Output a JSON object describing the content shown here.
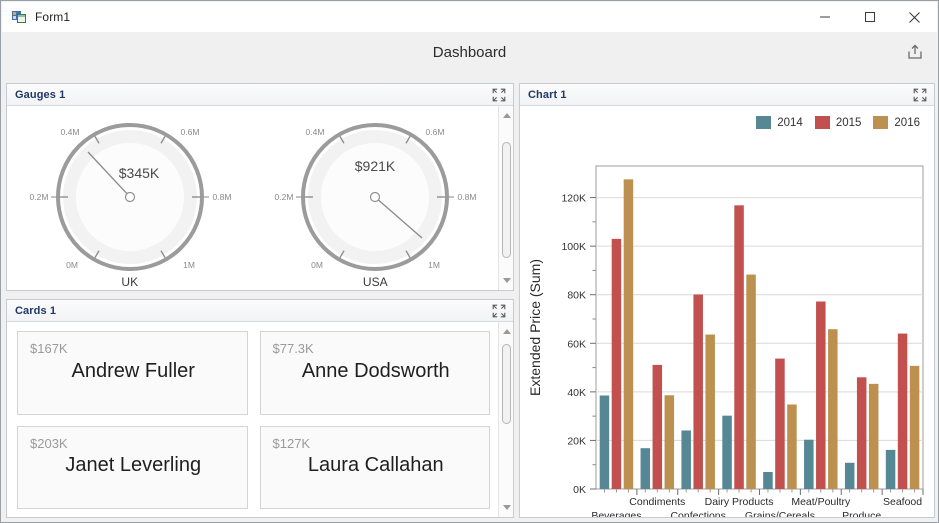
{
  "window": {
    "title": "Form1",
    "icon": "form-app-icon",
    "buttons": {
      "minimize": "minimize-icon",
      "maximize": "maximize-icon",
      "close": "close-icon"
    }
  },
  "header": {
    "title": "Dashboard",
    "export_icon": "export-icon"
  },
  "panels": {
    "gauges": {
      "title": "Gauges 1",
      "expand_icon": "expand-icon",
      "gauges": [
        {
          "name": "UK",
          "value_label": "$345K",
          "value": 345000,
          "min": 0,
          "max": 1000000,
          "ticks": [
            "0M",
            "0.2M",
            "0.4M",
            "0.6M",
            "0.8M",
            "1M"
          ]
        },
        {
          "name": "USA",
          "value_label": "$921K",
          "value": 921000,
          "min": 0,
          "max": 1000000,
          "ticks": [
            "0M",
            "0.2M",
            "0.4M",
            "0.6M",
            "0.8M",
            "1M"
          ]
        }
      ]
    },
    "cards": {
      "title": "Cards 1",
      "expand_icon": "expand-icon",
      "items": [
        {
          "value": "$167K",
          "name": "Andrew Fuller"
        },
        {
          "value": "$77.3K",
          "name": "Anne Dodsworth"
        },
        {
          "value": "$203K",
          "name": "Janet Leverling"
        },
        {
          "value": "$127K",
          "name": "Laura Callahan"
        }
      ]
    },
    "chart": {
      "title": "Chart 1",
      "expand_icon": "expand-icon"
    }
  },
  "chart_data": {
    "type": "bar",
    "title": "",
    "xlabel": "",
    "ylabel": "Extended Price (Sum)",
    "ylim": [
      0,
      133000
    ],
    "ytick_labels": [
      "0K",
      "20K",
      "40K",
      "60K",
      "80K",
      "100K",
      "120K"
    ],
    "ytick_values": [
      0,
      20000,
      40000,
      60000,
      80000,
      100000,
      120000
    ],
    "grid": true,
    "legend_position": "top-right",
    "categories": [
      "Beverages",
      "Condiments",
      "Confections",
      "Dairy Products",
      "Grains/Cereals",
      "Meat/Poultry",
      "Produce",
      "Seafood"
    ],
    "series": [
      {
        "name": "2014",
        "color": "#558894",
        "values": [
          38500,
          16800,
          24100,
          30200,
          7000,
          20300,
          10800,
          16100
        ]
      },
      {
        "name": "2015",
        "color": "#c1504e",
        "values": [
          103000,
          51100,
          80100,
          116800,
          53700,
          77200,
          46000,
          64000
        ]
      },
      {
        "name": "2016",
        "color": "#bc9150",
        "values": [
          127500,
          38600,
          63600,
          88300,
          34800,
          65800,
          43300,
          50700
        ]
      }
    ]
  },
  "colors": {
    "series_2014": "#558894",
    "series_2015": "#c1504e",
    "series_2016": "#bc9150",
    "panel_title": "#1f3864",
    "window_bg": "#f0f0f0"
  }
}
